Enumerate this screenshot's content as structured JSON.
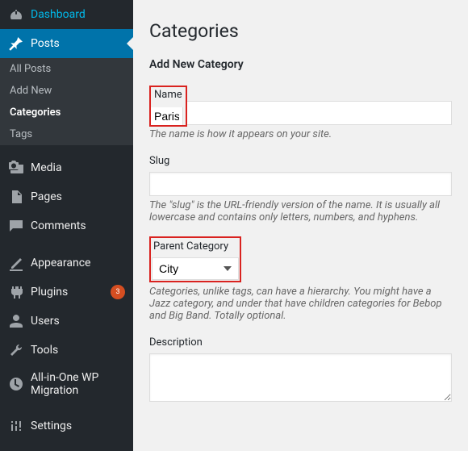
{
  "sidebar": {
    "dashboard": "Dashboard",
    "posts": "Posts",
    "posts_sub": {
      "all_posts": "All Posts",
      "add_new": "Add New",
      "categories": "Categories",
      "tags": "Tags"
    },
    "media": "Media",
    "pages": "Pages",
    "comments": "Comments",
    "appearance": "Appearance",
    "plugins": "Plugins",
    "plugins_badge": "3",
    "users": "Users",
    "tools": "Tools",
    "aio_migration": "All-in-One WP Migration",
    "settings": "Settings"
  },
  "page": {
    "title": "Categories",
    "section_title": "Add New Category",
    "name": {
      "label": "Name",
      "value": "Paris",
      "description": "The name is how it appears on your site."
    },
    "slug": {
      "label": "Slug",
      "value": "",
      "description": "The \"slug\" is the URL-friendly version of the name. It is usually all lowercase and contains only letters, numbers, and hyphens."
    },
    "parent": {
      "label": "Parent Category",
      "value": "City",
      "description": "Categories, unlike tags, can have a hierarchy. You might have a Jazz category, and under that have children categories for Bebop and Big Band. Totally optional."
    },
    "description": {
      "label": "Description",
      "value": ""
    }
  }
}
